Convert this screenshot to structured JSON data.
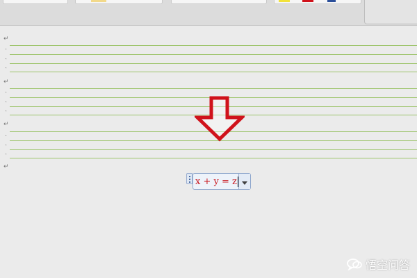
{
  "colors": {
    "rule_green": "#9cc46a",
    "equation_red": "#c8141c",
    "arrow_red": "#d0121b",
    "doc_background": "#ebebeb"
  },
  "toolbar": {
    "swatch_yellow": "#f2d98a",
    "swatch_red": "#d0121b",
    "swatch_blue": "#2b4f9a"
  },
  "document": {
    "paragraph_mark": "↵",
    "line_mark": "˺"
  },
  "equation": {
    "text": "x + y = z"
  },
  "watermark": {
    "text": "悟空问答"
  }
}
